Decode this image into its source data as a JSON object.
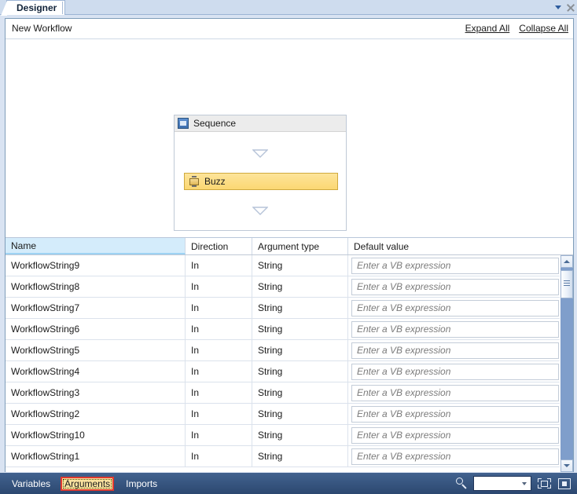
{
  "window": {
    "tab_label": "Designer",
    "dropdown_icon": "chevron-down-icon",
    "close_icon": "close-icon"
  },
  "designer": {
    "workflow_title": "New Workflow",
    "expand_all_label": "Expand All",
    "collapse_all_label": "Collapse All",
    "sequence": {
      "title": "Sequence",
      "icon": "sequence-icon",
      "activity": {
        "label": "Buzz",
        "icon": "activity-icon"
      },
      "drop_arrow_icon": "arrow-down-icon"
    }
  },
  "grid": {
    "columns": [
      "Name",
      "Direction",
      "Argument type",
      "Default value"
    ],
    "selected_column": "Name",
    "default_value_placeholder": "Enter a VB expression",
    "rows": [
      {
        "name": "WorkflowString9",
        "direction": "In",
        "type": "String",
        "default": ""
      },
      {
        "name": "WorkflowString8",
        "direction": "In",
        "type": "String",
        "default": ""
      },
      {
        "name": "WorkflowString7",
        "direction": "In",
        "type": "String",
        "default": ""
      },
      {
        "name": "WorkflowString6",
        "direction": "In",
        "type": "String",
        "default": ""
      },
      {
        "name": "WorkflowString5",
        "direction": "In",
        "type": "String",
        "default": ""
      },
      {
        "name": "WorkflowString4",
        "direction": "In",
        "type": "String",
        "default": ""
      },
      {
        "name": "WorkflowString3",
        "direction": "In",
        "type": "String",
        "default": ""
      },
      {
        "name": "WorkflowString2",
        "direction": "In",
        "type": "String",
        "default": ""
      },
      {
        "name": "WorkflowString10",
        "direction": "In",
        "type": "String",
        "default": ""
      },
      {
        "name": "WorkflowString1",
        "direction": "In",
        "type": "String",
        "default": ""
      }
    ],
    "scrollbar": {
      "up_icon": "scroll-up-icon",
      "down_icon": "scroll-down-icon"
    }
  },
  "bottom_bar": {
    "tabs": [
      {
        "label": "Variables",
        "active": false
      },
      {
        "label": "Arguments",
        "active": true
      },
      {
        "label": "Imports",
        "active": false
      }
    ],
    "zoom_search_icon": "magnifier-icon",
    "zoom_value": "",
    "fit_to_screen_icon": "fit-to-screen-icon",
    "overview_icon": "overview-icon",
    "highlight_color": "#e03a2f"
  }
}
